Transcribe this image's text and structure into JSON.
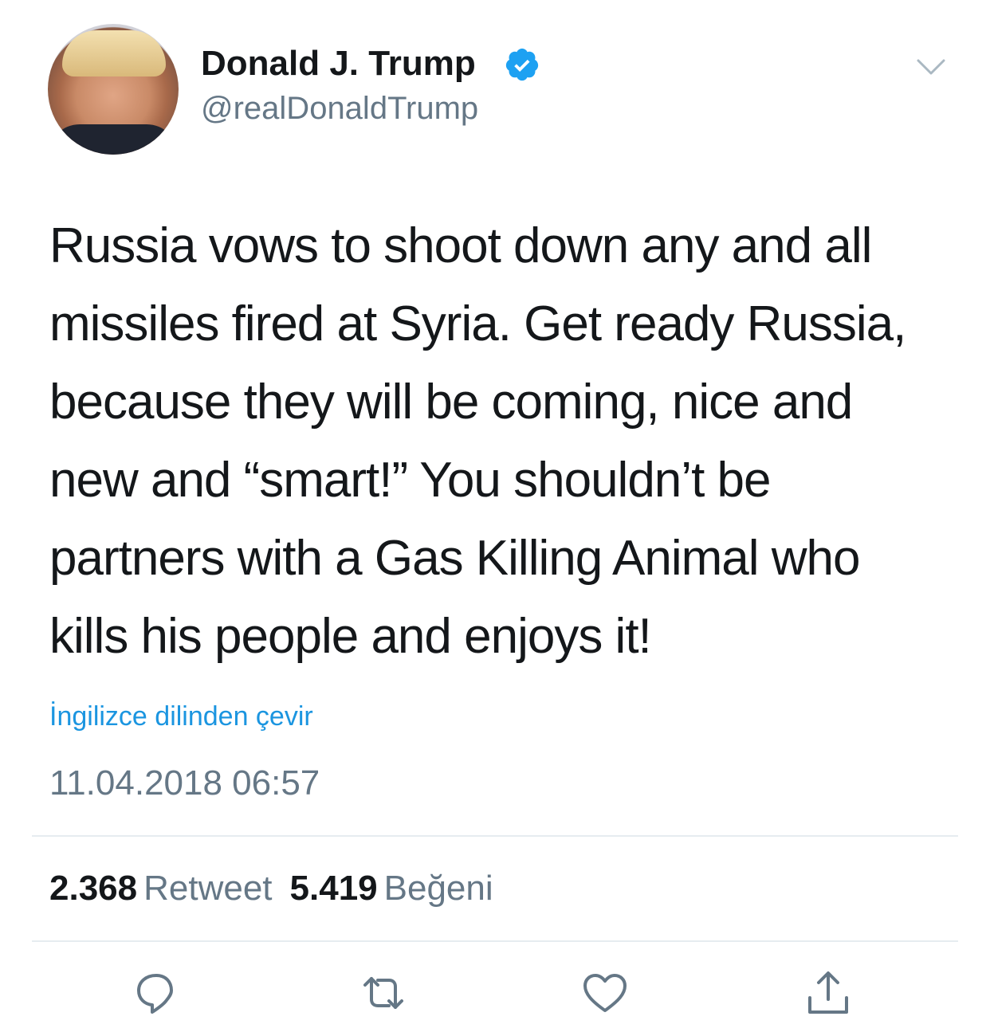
{
  "author": {
    "display_name": "Donald J. Trump",
    "handle": "@realDonaldTrump",
    "verified": true
  },
  "tweet": {
    "text": "Russia vows to shoot down any and all missiles fired at Syria. Get ready Russia, because they will be coming, nice and new and “smart!” You shouldn’t be partners with a Gas Killing Animal who kills his people and enjoys it!",
    "translate_link": "İngilizce dilinden çevir",
    "timestamp": "11.04.2018 06:57"
  },
  "stats": {
    "retweet_count": "2.368",
    "retweet_label": "Retweet",
    "like_count": "5.419",
    "like_label": "Beğeni"
  },
  "actions": [
    {
      "icon": "reply-icon"
    },
    {
      "icon": "retweet-icon"
    },
    {
      "icon": "like-icon"
    },
    {
      "icon": "share-icon"
    }
  ],
  "colors": {
    "accent": "#1b95e0",
    "verified_badge": "#1da1f2",
    "secondary_text": "#657786",
    "primary_text": "#14171a"
  }
}
